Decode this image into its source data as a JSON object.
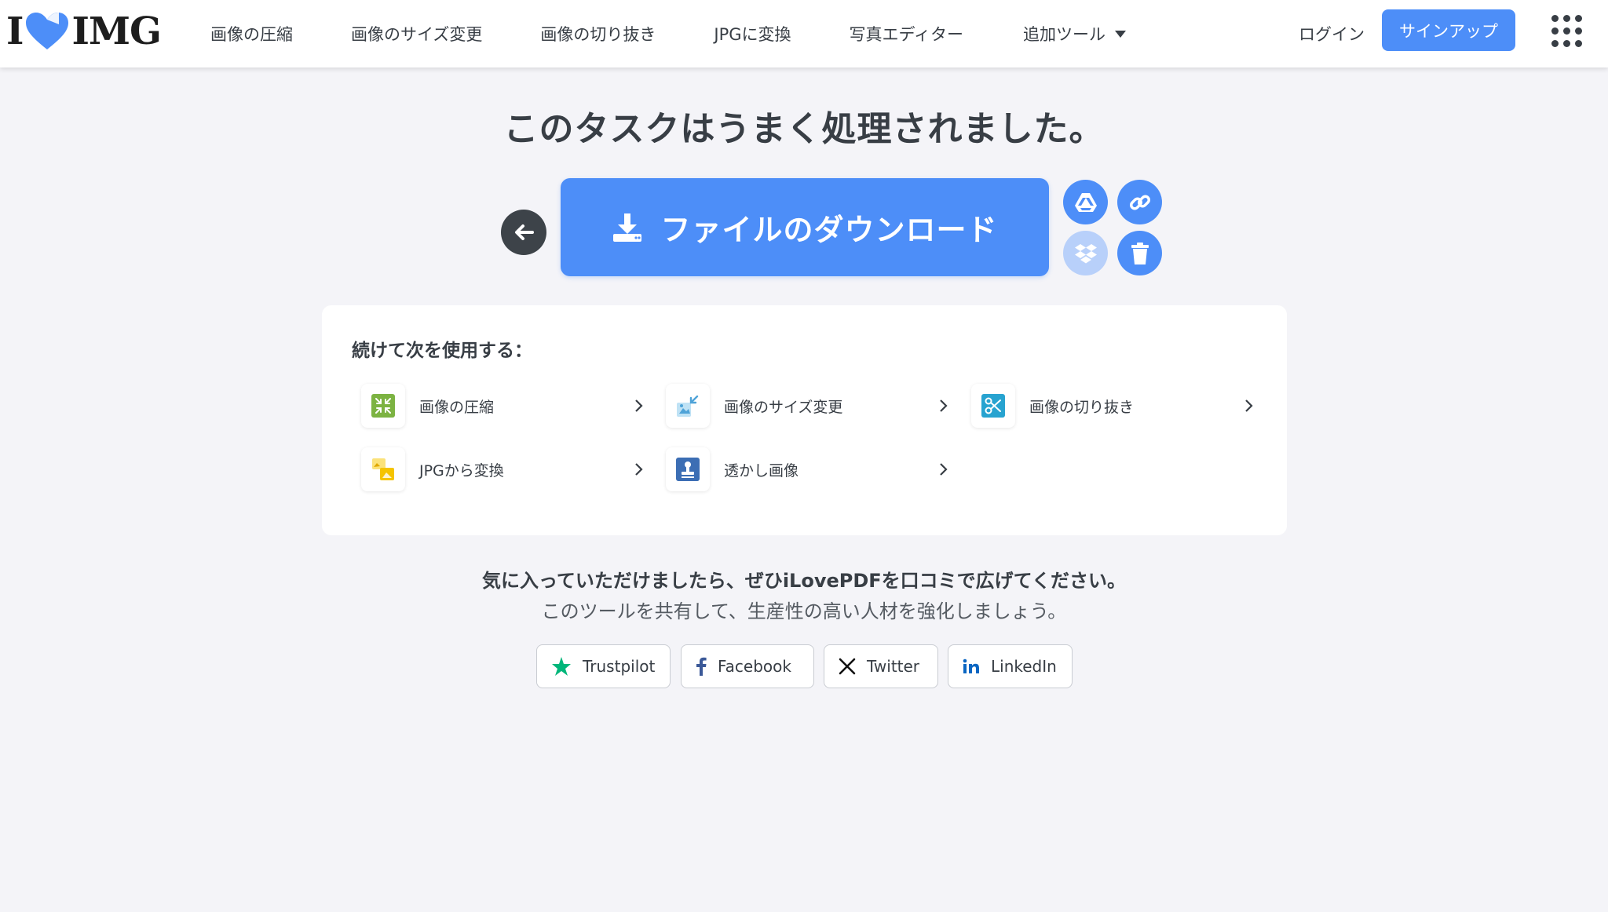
{
  "header": {
    "logo_left": "I",
    "logo_right": "IMG",
    "nav": [
      {
        "label": "画像の圧縮"
      },
      {
        "label": "画像のサイズ変更"
      },
      {
        "label": "画像の切り抜き"
      },
      {
        "label": "JPGに変換"
      },
      {
        "label": "写真エディター"
      },
      {
        "label": "追加ツール"
      }
    ],
    "login": "ログイン",
    "signup": "サインアップ"
  },
  "main": {
    "title": "このタスクはうまく処理されました。",
    "download_label": "ファイルのダウンロード"
  },
  "continue": {
    "title": "続けて次を使用する：",
    "tools": [
      {
        "label": "画像の圧縮",
        "icon": "compress-icon",
        "color": "#7cb342"
      },
      {
        "label": "画像のサイズ変更",
        "icon": "resize-icon",
        "color": "#4fa3d8"
      },
      {
        "label": "画像の切り抜き",
        "icon": "crop-icon",
        "color": "#27a3d0"
      },
      {
        "label": "JPGから変換",
        "icon": "convert-from-jpg-icon",
        "color": "#f5c400"
      },
      {
        "label": "透かし画像",
        "icon": "watermark-icon",
        "color": "#3c6eb4"
      }
    ]
  },
  "share": {
    "title": "気に入っていただけましたら、ぜひiLovePDFを口コミで広げてください。",
    "subtitle": "このツールを共有して、生産性の高い人材を強化しましょう。",
    "buttons": [
      {
        "label": "Trustpilot",
        "icon": "trustpilot-icon",
        "color": "#00b67a"
      },
      {
        "label": "Facebook",
        "icon": "facebook-icon",
        "color": "#3b5998"
      },
      {
        "label": "Twitter",
        "icon": "x-twitter-icon",
        "color": "#111111"
      },
      {
        "label": "LinkedIn",
        "icon": "linkedin-icon",
        "color": "#0a66c2"
      }
    ]
  },
  "colors": {
    "accent": "#4d8ef8",
    "background": "#f4f4f8",
    "text": "#383e45"
  }
}
